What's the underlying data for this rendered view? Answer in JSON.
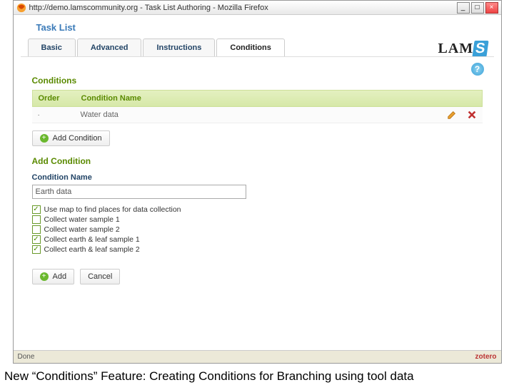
{
  "window": {
    "url_title": "http://demo.lamscommunity.org - Task List Authoring - Mozilla Firefox",
    "min": "_",
    "max": "□",
    "close": "×"
  },
  "page_heading": "Task List",
  "logo": {
    "left": "LAM",
    "right": "S"
  },
  "tabs": [
    {
      "label": "Basic",
      "active": false
    },
    {
      "label": "Advanced",
      "active": false
    },
    {
      "label": "Instructions",
      "active": false
    },
    {
      "label": "Conditions",
      "active": true
    }
  ],
  "help": "?",
  "conditions": {
    "title": "Conditions",
    "headers": {
      "order": "Order",
      "name": "Condition Name"
    },
    "rows": [
      {
        "order": "·",
        "name": "Water data"
      }
    ],
    "add_btn": "Add Condition"
  },
  "add_condition": {
    "title": "Add Condition",
    "name_label": "Condition Name",
    "name_value": "Earth data",
    "tasks": [
      {
        "label": "Use map to find places for data collection",
        "checked": true
      },
      {
        "label": "Collect water sample 1",
        "checked": false
      },
      {
        "label": "Collect water sample 2",
        "checked": false
      },
      {
        "label": "Collect earth & leaf sample 1",
        "checked": true
      },
      {
        "label": "Collect earth & leaf sample 2",
        "checked": true
      }
    ],
    "add_btn": "Add",
    "cancel_btn": "Cancel"
  },
  "status": {
    "left": "Done",
    "right": "zotero"
  },
  "caption": "New “Conditions” Feature: Creating Conditions for Branching using tool data"
}
